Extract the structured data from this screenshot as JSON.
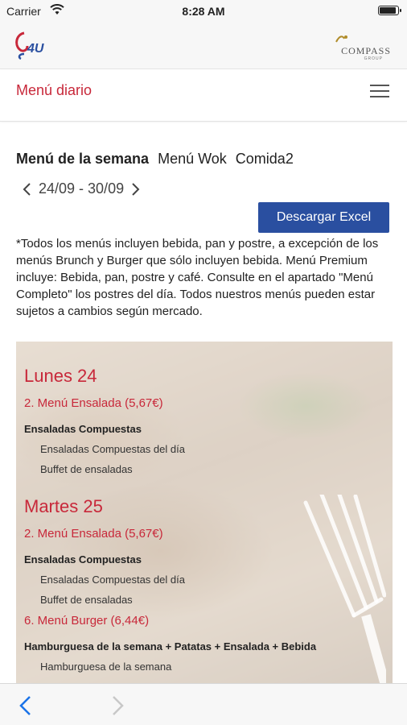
{
  "status_bar": {
    "carrier": "Carrier",
    "time": "8:28 AM"
  },
  "brand": {
    "app_logo_text": "4U",
    "partner_logo_text": "COMPASS",
    "partner_logo_sub": "GROUP"
  },
  "nav": {
    "title": "Menú diario"
  },
  "tabs": [
    {
      "label": "Menú de la semana",
      "active": true
    },
    {
      "label": "Menú Wok",
      "active": false
    },
    {
      "label": "Comida2",
      "active": false
    }
  ],
  "week": {
    "label": "24/09 - 30/09"
  },
  "actions": {
    "download_excel": "Descargar Excel"
  },
  "disclaimer": "*Todos los menús incluyen bebida, pan y postre, a excepción de los menús Brunch y Burger que sólo incluyen bebida. Menú Premium incluye: Bebida, pan, postre y café. Consulte en el apartado \"Menú Completo\" los postres del día. Todos nuestros menús pueden estar sujetos a cambios según mercado.",
  "days": [
    {
      "title": "Lunes 24",
      "menus": [
        {
          "name": "2. Menú Ensalada (5,67€)",
          "category": "Ensaladas Compuestas",
          "dishes": [
            "Ensaladas Compuestas del día",
            "Buffet de ensaladas"
          ]
        }
      ]
    },
    {
      "title": "Martes 25",
      "menus": [
        {
          "name": "2. Menú Ensalada (5,67€)",
          "category": "Ensaladas Compuestas",
          "dishes": [
            "Ensaladas Compuestas del día",
            "Buffet de ensaladas"
          ]
        },
        {
          "name": "6. Menú Burger (6,44€)",
          "category": "Hamburguesa de la semana + Patatas + Ensalada + Bebida",
          "dishes": [
            "Hamburguesa de la semana"
          ]
        }
      ]
    }
  ],
  "colors": {
    "accent_red": "#c8283a",
    "button_blue": "#2a4fa0",
    "ios_blue": "#1a73e8"
  }
}
